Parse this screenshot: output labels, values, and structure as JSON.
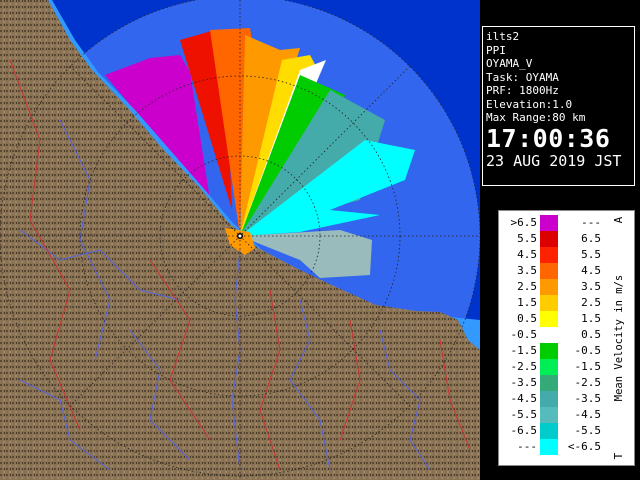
{
  "panel": {
    "lines": [
      "ilts2",
      "PPI",
      "OYAMA_V",
      "Task: OYAMA",
      "PRF: 1800Hz",
      "Elevation:1.0",
      "Max Range:80 km"
    ],
    "time": "17:00:36",
    "date": "23 AUG 2019 JST"
  },
  "legend": {
    "unit": "Mean Velocity in m/s",
    "top_marker": "A",
    "bottom_marker": "T",
    "rows": [
      {
        "lo": ">6.5",
        "hi": "---",
        "color": "#cc00cc"
      },
      {
        "lo": "5.5",
        "hi": "6.5",
        "color": "#dd0000"
      },
      {
        "lo": "4.5",
        "hi": "5.5",
        "color": "#ff2200"
      },
      {
        "lo": "3.5",
        "hi": "4.5",
        "color": "#ff6600"
      },
      {
        "lo": "2.5",
        "hi": "3.5",
        "color": "#ff9900"
      },
      {
        "lo": "1.5",
        "hi": "2.5",
        "color": "#ffcc00"
      },
      {
        "lo": "0.5",
        "hi": "1.5",
        "color": "#ffff00"
      },
      {
        "lo": "-0.5",
        "hi": "0.5",
        "color": "#ffffff"
      },
      {
        "lo": "-1.5",
        "hi": "-0.5",
        "color": "#00cc00"
      },
      {
        "lo": "-2.5",
        "hi": "-1.5",
        "color": "#00ee55"
      },
      {
        "lo": "-3.5",
        "hi": "-2.5",
        "color": "#33aa77"
      },
      {
        "lo": "-4.5",
        "hi": "-3.5",
        "color": "#44aaaa"
      },
      {
        "lo": "-5.5",
        "hi": "-4.5",
        "color": "#55bbbb"
      },
      {
        "lo": "-6.5",
        "hi": "-5.5",
        "color": "#00cccc"
      },
      {
        "lo": "---",
        "hi": "<-6.5",
        "color": "#00ffff"
      }
    ]
  },
  "colors": {
    "sea": "#0033cc",
    "range_disc": "#3366ee",
    "coast": "#3399ff",
    "land": "#8a7355",
    "land_dark": "#5e4a33",
    "river": "#5566dd",
    "boundary": "#cc3333"
  }
}
